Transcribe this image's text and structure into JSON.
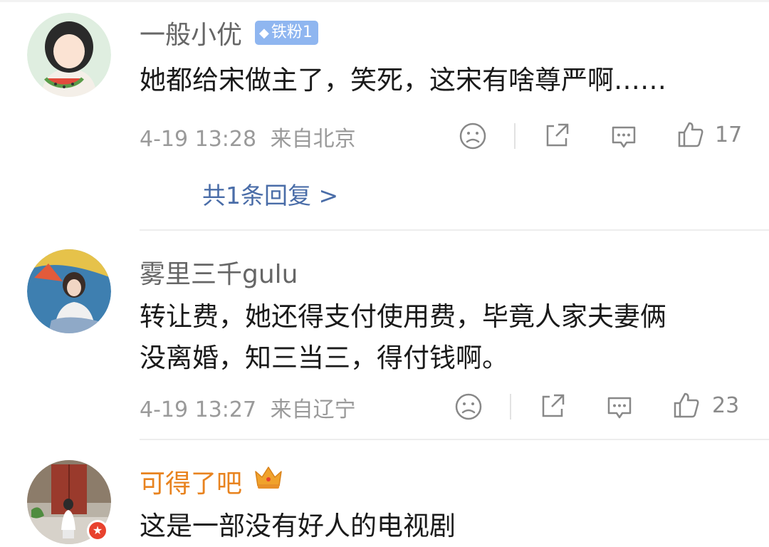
{
  "comments": [
    {
      "username": "一般小优",
      "badge": "铁粉1",
      "text_lines": [
        "她都给宋做主了，笑死，这宋有啥尊严啊……"
      ],
      "time": "4-19 13:28",
      "location": "来自北京",
      "likes": "17",
      "reply_summary": "共1条回复 >"
    },
    {
      "username": "雾里三千gulu",
      "text_lines": [
        "转让费，她还得支付使用费，毕竟人家夫妻俩",
        "没离婚，知三当三，得付钱啊。"
      ],
      "time": "4-19 13:27",
      "location": "来自辽宁",
      "likes": "23"
    },
    {
      "username": "可得了吧",
      "text_lines": [
        "这是一部没有好人的电视剧"
      ]
    }
  ],
  "icons": {
    "badge": "diamond-icon",
    "vip": "crown-icon",
    "dislike": "sad-face-icon",
    "share": "share-icon",
    "comment": "comment-icon",
    "like": "thumb-up-icon",
    "verified": "verified-star-icon"
  },
  "colors": {
    "username": "#666666",
    "vip_username": "#e8831f",
    "text": "#1a1a1a",
    "meta": "#9a9a9a",
    "link": "#4a6da8",
    "badge": "#8fb6f0",
    "verified_badge": "#e8422e"
  }
}
